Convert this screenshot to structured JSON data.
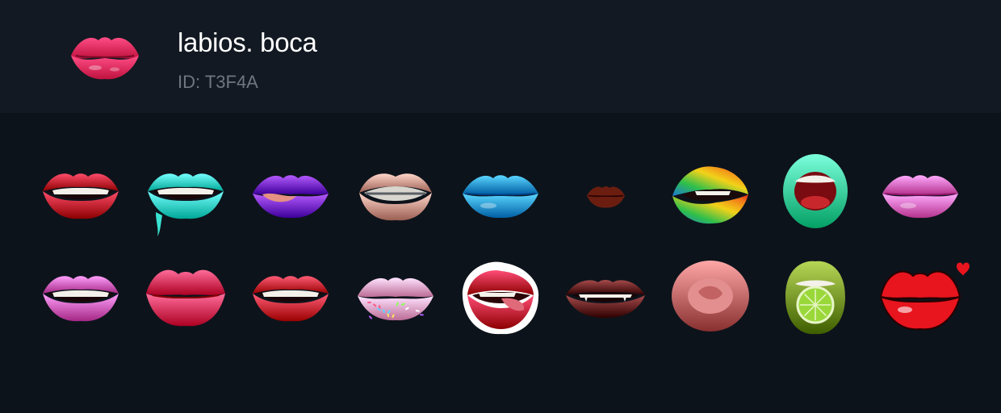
{
  "pack": {
    "title": "labios. boca",
    "id_label": "ID: T3F4A",
    "thumbnail": {
      "name": "pink-pucker-lips",
      "color": "#e0245a"
    }
  },
  "stickers": [
    {
      "name": "red-smile-lips",
      "lip": "#c8102e",
      "shape": "smile"
    },
    {
      "name": "teal-drip-lips",
      "lip": "#39e3d2",
      "shape": "bite"
    },
    {
      "name": "purple-tongue-lips",
      "lip": "#7a1fd6",
      "shape": "tongue"
    },
    {
      "name": "braces-lips",
      "lip": "#d79a8e",
      "shape": "braces"
    },
    {
      "name": "blue-lips",
      "lip": "#1f9be0",
      "shape": "closed"
    },
    {
      "name": "brown-kiss-print",
      "lip": "#6b1e10",
      "shape": "kiss"
    },
    {
      "name": "rainbow-lips",
      "lip": "#f2b419",
      "shape": "rainbow"
    },
    {
      "name": "green-open-mouth",
      "lip": "#3fdca0",
      "shape": "open"
    },
    {
      "name": "pink-lips",
      "lip": "#f06fc8",
      "shape": "closed"
    },
    {
      "name": "glitter-lips",
      "lip": "#e063c0",
      "shape": "smile"
    },
    {
      "name": "pink-pout-lips",
      "lip": "#e8305e",
      "shape": "pout"
    },
    {
      "name": "bite-lips",
      "lip": "#d6203a",
      "shape": "smile"
    },
    {
      "name": "sprinkle-lips",
      "lip": "#f7a8d2",
      "shape": "sprinkle"
    },
    {
      "name": "licking-lips",
      "lip": "#c8103a",
      "shape": "lick"
    },
    {
      "name": "vampire-lips",
      "lip": "#6a0f0f",
      "shape": "vampire"
    },
    {
      "name": "curled-tongue-lips",
      "lip": "#c46b6b",
      "shape": "curl"
    },
    {
      "name": "lime-lips",
      "lip": "#7a9a1a",
      "shape": "lime"
    },
    {
      "name": "cartoon-heart-lips",
      "lip": "#e8141e",
      "shape": "heart"
    }
  ]
}
